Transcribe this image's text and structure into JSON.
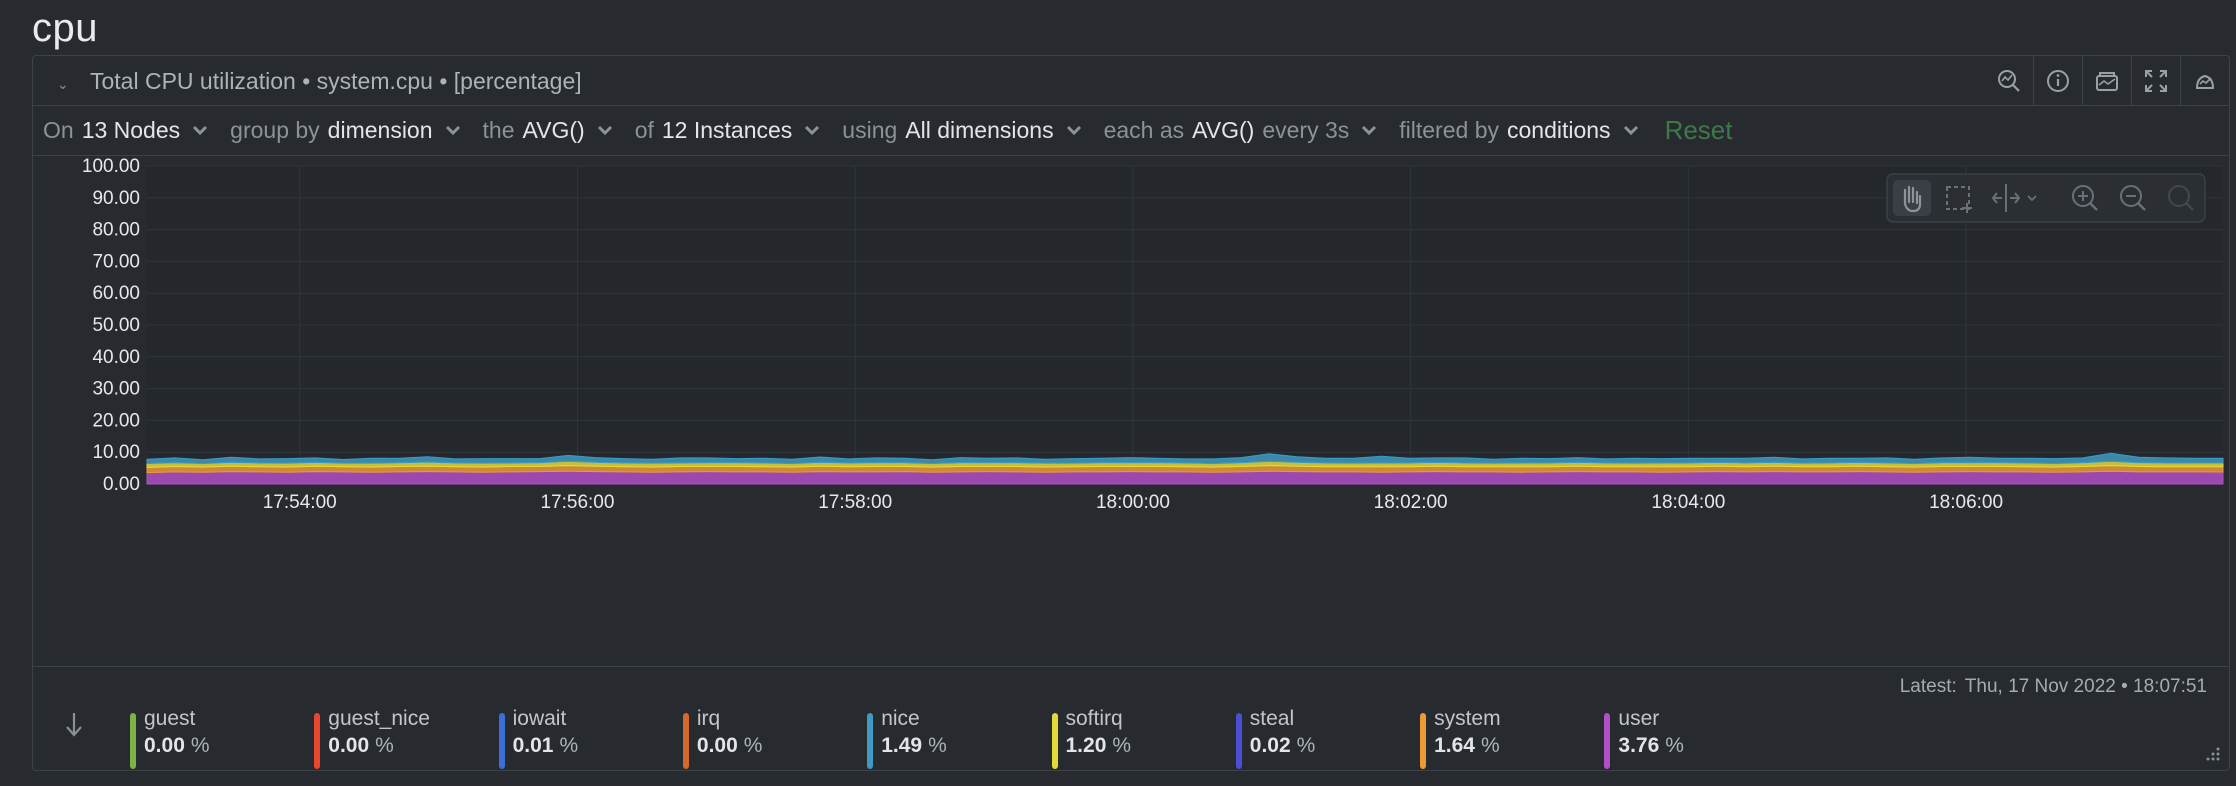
{
  "section": {
    "title": "cpu"
  },
  "chart_header": {
    "title": "Total CPU utilization • system.cpu • [percentage]",
    "icons": [
      "search-chart-icon",
      "info-icon",
      "layers-icon",
      "fullscreen-icon",
      "alert-icon"
    ]
  },
  "controls": {
    "on_label": "On",
    "on_value": "13 Nodes",
    "group_label": "group by",
    "group_value": "dimension",
    "agg_label": "the",
    "agg_value": "AVG()",
    "of_label": "of",
    "of_value": "12 Instances",
    "using_label": "using",
    "using_value": "All dimensions",
    "each_label": "each as",
    "each_value": "AVG()",
    "every_value": "every 3s",
    "filter_label": "filtered by",
    "filter_value": "conditions",
    "reset_label": "Reset"
  },
  "toolbar": {
    "tools": [
      "pan-icon",
      "select-area-icon",
      "compare-icon",
      "zoom-in-icon",
      "zoom-out-icon",
      "reset-zoom-icon"
    ]
  },
  "legend": {
    "latest_label": "Latest:",
    "latest_value": "Thu, 17 Nov 2022 • 18:07:51",
    "items": [
      {
        "name": "guest",
        "value": "0.00",
        "unit": "%",
        "color": "#7cb342"
      },
      {
        "name": "guest_nice",
        "value": "0.00",
        "unit": "%",
        "color": "#e8472e"
      },
      {
        "name": "iowait",
        "value": "0.01",
        "unit": "%",
        "color": "#3a6fd8"
      },
      {
        "name": "irq",
        "value": "0.00",
        "unit": "%",
        "color": "#d26a2a"
      },
      {
        "name": "nice",
        "value": "1.49",
        "unit": "%",
        "color": "#3e9ac4"
      },
      {
        "name": "softirq",
        "value": "1.20",
        "unit": "%",
        "color": "#e2d93d"
      },
      {
        "name": "steal",
        "value": "0.02",
        "unit": "%",
        "color": "#4b4fd4"
      },
      {
        "name": "system",
        "value": "1.64",
        "unit": "%",
        "color": "#ec9a35"
      },
      {
        "name": "user",
        "value": "3.76",
        "unit": "%",
        "color": "#b04fc6"
      }
    ]
  },
  "chart_data": {
    "type": "area",
    "stacked": true,
    "ylim": [
      0,
      100
    ],
    "yticks": [
      "100.00",
      "90.00",
      "80.00",
      "70.00",
      "60.00",
      "50.00",
      "40.00",
      "30.00",
      "20.00",
      "10.00",
      "0.00"
    ],
    "xticks": [
      "17:54:00",
      "17:56:00",
      "17:58:00",
      "18:00:00",
      "18:02:00",
      "18:04:00",
      "18:06:00"
    ],
    "x_start": "17:52:54",
    "x_end": "18:07:51",
    "grid": true,
    "series": [
      {
        "name": "user",
        "color": "#b04fc6",
        "values": [
          3.6,
          3.8,
          3.7,
          3.9,
          3.8,
          3.7,
          3.9,
          3.8,
          3.7,
          3.8,
          3.9,
          3.8,
          3.7,
          3.8,
          3.9,
          4.0,
          3.9,
          3.8,
          3.7,
          3.8,
          3.9,
          3.8,
          3.8,
          3.7,
          3.9,
          3.8,
          3.8,
          3.9,
          3.7,
          3.8,
          3.9,
          3.8,
          3.7,
          3.8,
          3.8,
          3.9,
          3.8,
          3.8,
          3.7,
          3.8,
          4.0,
          3.9,
          3.8,
          3.8,
          3.7,
          3.8,
          3.9,
          3.8,
          3.8,
          3.7,
          3.8,
          3.9,
          3.8,
          3.8,
          3.7,
          3.8,
          3.9,
          3.8,
          3.9,
          3.8,
          3.8,
          3.9,
          3.8,
          3.7,
          3.8,
          3.9,
          3.8,
          3.8,
          3.7,
          3.8,
          4.0,
          3.8,
          3.8,
          3.8,
          3.76
        ]
      },
      {
        "name": "system",
        "color": "#ec9a35",
        "values": [
          1.6,
          1.7,
          1.6,
          1.7,
          1.6,
          1.6,
          1.7,
          1.6,
          1.6,
          1.7,
          1.7,
          1.6,
          1.6,
          1.7,
          1.6,
          1.8,
          1.7,
          1.6,
          1.6,
          1.7,
          1.6,
          1.7,
          1.6,
          1.6,
          1.7,
          1.6,
          1.7,
          1.6,
          1.6,
          1.7,
          1.6,
          1.7,
          1.6,
          1.6,
          1.7,
          1.6,
          1.7,
          1.6,
          1.6,
          1.7,
          1.8,
          1.7,
          1.6,
          1.6,
          1.7,
          1.6,
          1.7,
          1.6,
          1.6,
          1.7,
          1.6,
          1.7,
          1.6,
          1.6,
          1.7,
          1.6,
          1.7,
          1.6,
          1.7,
          1.6,
          1.6,
          1.7,
          1.6,
          1.6,
          1.7,
          1.6,
          1.7,
          1.6,
          1.6,
          1.7,
          1.8,
          1.7,
          1.6,
          1.6,
          1.64
        ]
      },
      {
        "name": "softirq",
        "color": "#e2d93d",
        "values": [
          1.2,
          1.2,
          1.1,
          1.2,
          1.2,
          1.2,
          1.2,
          1.1,
          1.2,
          1.2,
          1.3,
          1.2,
          1.2,
          1.1,
          1.2,
          1.3,
          1.2,
          1.2,
          1.2,
          1.1,
          1.2,
          1.2,
          1.2,
          1.1,
          1.2,
          1.2,
          1.2,
          1.2,
          1.1,
          1.2,
          1.2,
          1.2,
          1.2,
          1.1,
          1.2,
          1.2,
          1.2,
          1.2,
          1.1,
          1.2,
          1.3,
          1.2,
          1.2,
          1.1,
          1.2,
          1.2,
          1.2,
          1.2,
          1.1,
          1.2,
          1.2,
          1.2,
          1.2,
          1.1,
          1.2,
          1.2,
          1.2,
          1.2,
          1.2,
          1.1,
          1.2,
          1.2,
          1.2,
          1.1,
          1.2,
          1.2,
          1.2,
          1.2,
          1.1,
          1.2,
          1.3,
          1.2,
          1.2,
          1.2,
          1.2
        ]
      },
      {
        "name": "nice",
        "color": "#3e9ac4",
        "values": [
          1.4,
          1.5,
          1.2,
          1.6,
          1.3,
          1.5,
          1.4,
          1.2,
          1.6,
          1.4,
          1.7,
          1.3,
          1.5,
          1.4,
          1.3,
          1.9,
          1.5,
          1.4,
          1.3,
          1.6,
          1.5,
          1.3,
          1.5,
          1.4,
          1.7,
          1.3,
          1.5,
          1.4,
          1.2,
          1.6,
          1.4,
          1.5,
          1.3,
          1.5,
          1.4,
          1.6,
          1.4,
          1.3,
          1.5,
          1.6,
          2.4,
          1.8,
          1.5,
          1.6,
          2.1,
          1.5,
          1.4,
          1.6,
          1.3,
          1.5,
          1.4,
          1.5,
          1.3,
          1.6,
          1.4,
          1.5,
          1.3,
          1.5,
          1.6,
          1.4,
          1.5,
          1.3,
          1.6,
          1.4,
          1.5,
          1.7,
          1.4,
          1.5,
          1.6,
          1.5,
          2.6,
          1.7,
          1.6,
          1.5,
          1.49
        ]
      }
    ]
  }
}
